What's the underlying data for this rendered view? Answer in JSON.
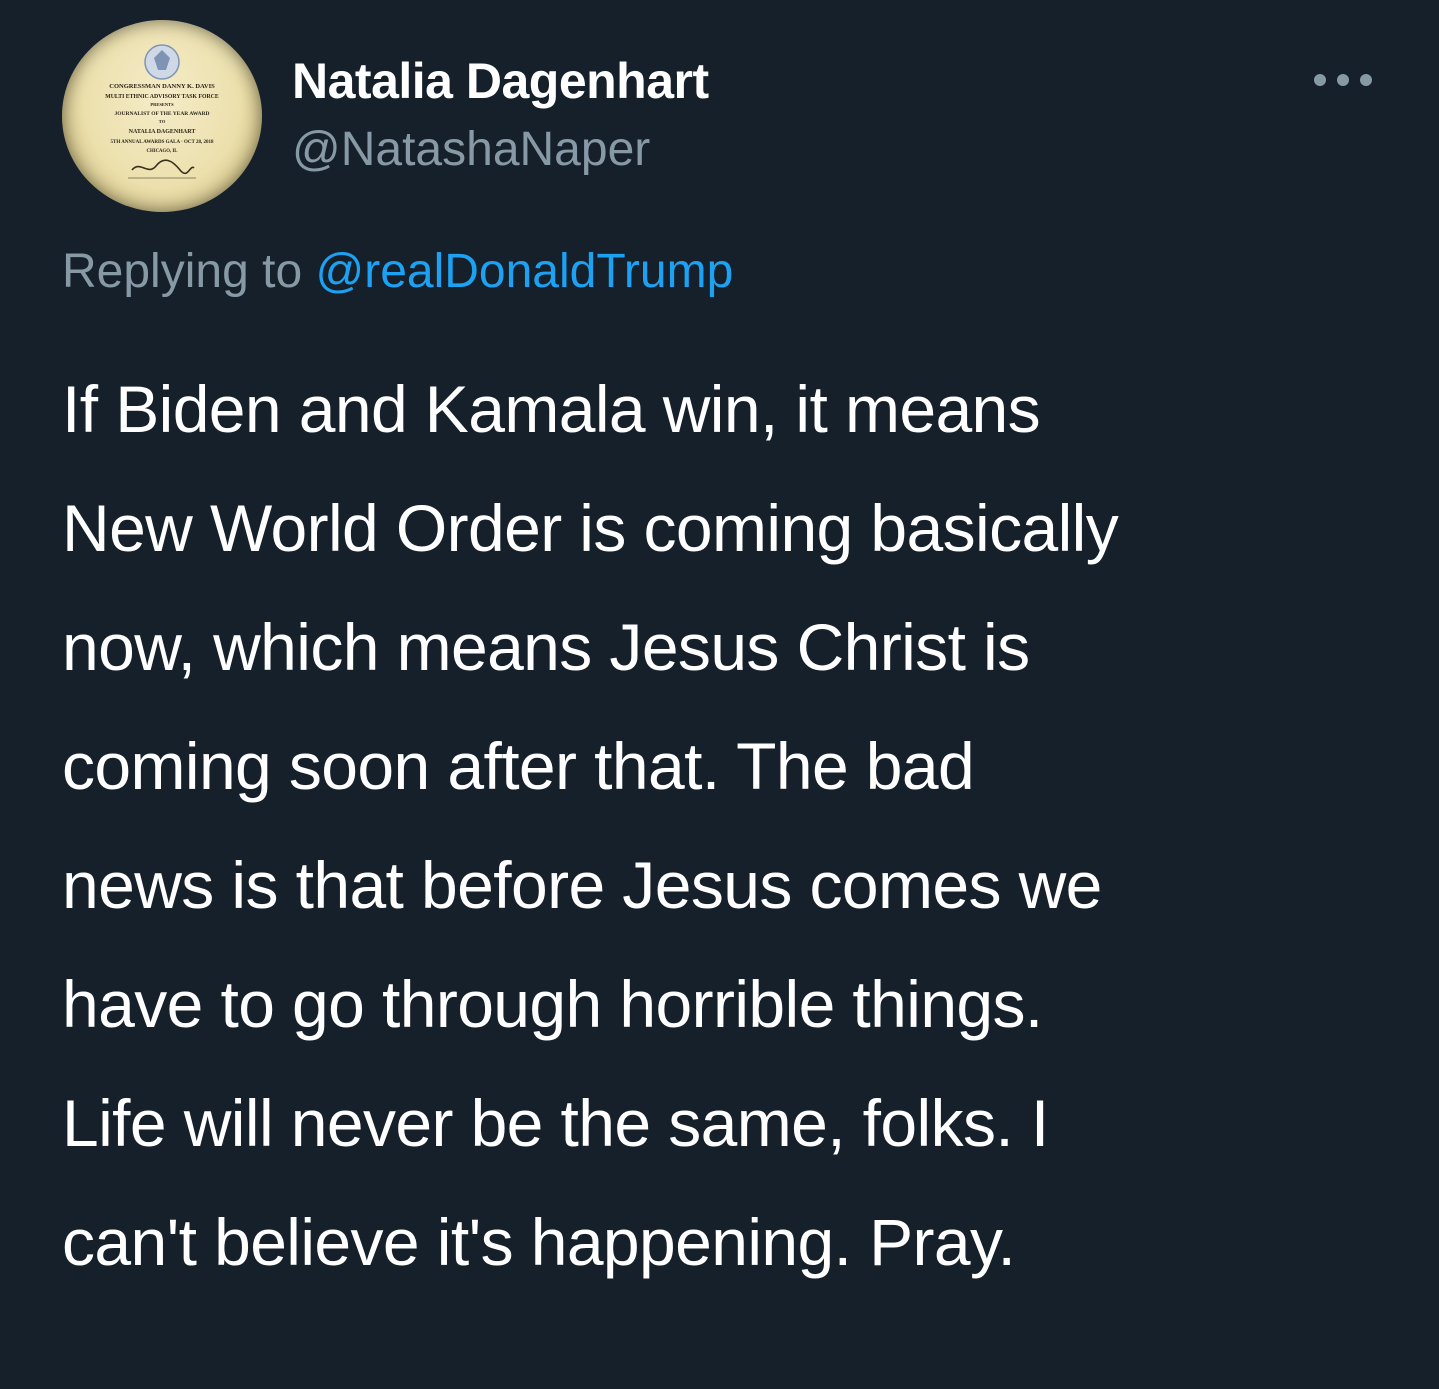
{
  "author": {
    "display_name": "Natalia Dagenhart",
    "handle": "@NatashaNaper"
  },
  "avatar": {
    "plaque_lines": [
      "CONGRESSMAN DANNY K. DAVIS",
      "MULTI ETHNIC ADVISORY TASK FORCE",
      "PRESENTS",
      "JOURNALIST OF THE YEAR AWARD",
      "TO",
      "NATALIA DAGENHART",
      "5TH ANNUAL AWARDS GALA · OCT 28, 2018",
      "CHICAGO, IL"
    ]
  },
  "more_icon": "more-horizontal-icon",
  "reply": {
    "prefix": "Replying to ",
    "mention": "@realDonaldTrump"
  },
  "tweet": {
    "lines": [
      "If Biden and Kamala win, it means",
      "New World Order is coming basically",
      "now, which means Jesus Christ is",
      "coming soon after that. The bad",
      "news is that before Jesus comes we",
      "have to go through horrible things.",
      "Life will never be the same, folks. I",
      "can't believe it's happening. Pray."
    ]
  },
  "colors": {
    "background": "#15202b",
    "primary_text": "#ffffff",
    "secondary_text": "#8899a6",
    "link": "#1da1f2"
  }
}
